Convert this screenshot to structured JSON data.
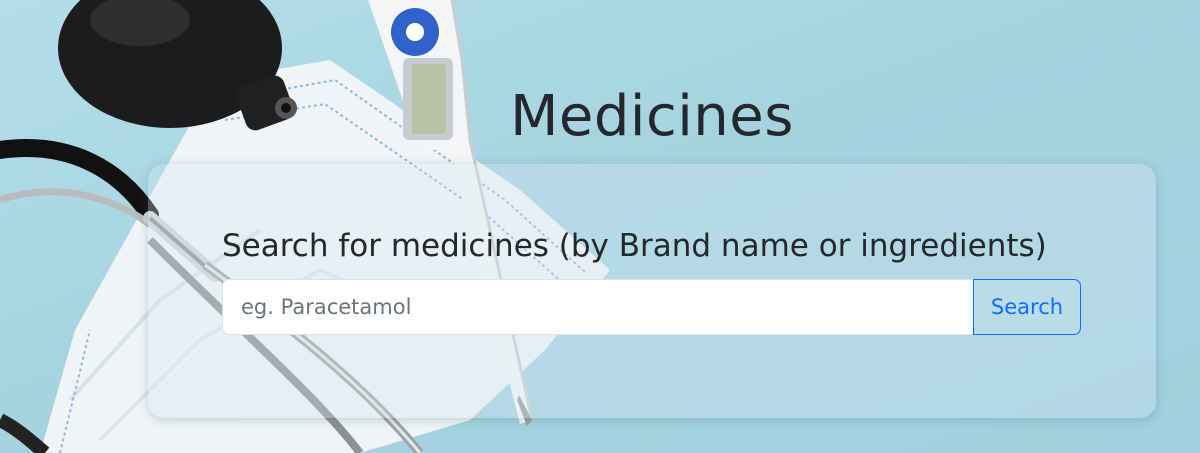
{
  "page": {
    "title": "Medicines"
  },
  "search": {
    "heading": "Search for medicines (by Brand name or ingredients)",
    "placeholder": "eg. Paracetamol",
    "value": "",
    "button_label": "Search"
  },
  "theme": {
    "background": "#a9d6e3",
    "accent": "#0d6efd",
    "text": "#24282d"
  }
}
